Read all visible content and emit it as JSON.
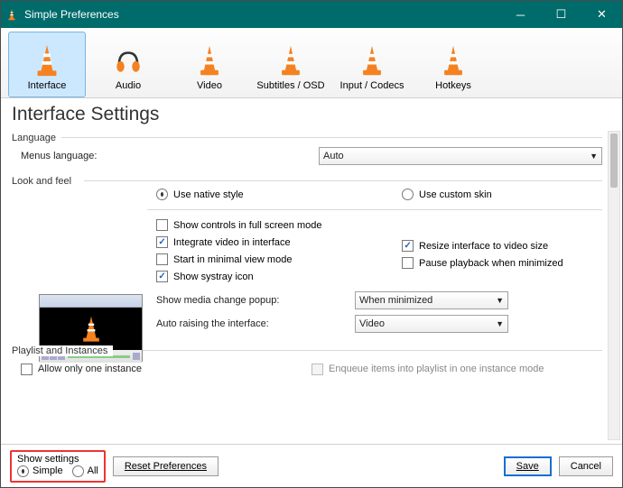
{
  "window": {
    "title": "Simple Preferences"
  },
  "tabs": [
    {
      "label": "Interface",
      "active": true
    },
    {
      "label": "Audio"
    },
    {
      "label": "Video"
    },
    {
      "label": "Subtitles / OSD"
    },
    {
      "label": "Input / Codecs"
    },
    {
      "label": "Hotkeys"
    }
  ],
  "heading": "Interface Settings",
  "language": {
    "group": "Language",
    "menus_label": "Menus language:",
    "menus_value": "Auto"
  },
  "look": {
    "group": "Look and feel",
    "native": "Use native style",
    "custom": "Use custom skin",
    "show_controls": "Show controls in full screen mode",
    "integrate": "Integrate video in interface",
    "minimal": "Start in minimal view mode",
    "systray": "Show systray icon",
    "resize": "Resize interface to video size",
    "pause_min": "Pause playback when minimized",
    "media_popup_label": "Show media change popup:",
    "media_popup_value": "When minimized",
    "auto_raise_label": "Auto raising the interface:",
    "auto_raise_value": "Video"
  },
  "playlist": {
    "group": "Playlist and Instances",
    "allow_one": "Allow only one instance",
    "enqueue": "Enqueue items into playlist in one instance mode"
  },
  "footer": {
    "show_settings": "Show settings",
    "simple": "Simple",
    "all": "All",
    "reset": "Reset Preferences",
    "save": "Save",
    "cancel": "Cancel"
  }
}
